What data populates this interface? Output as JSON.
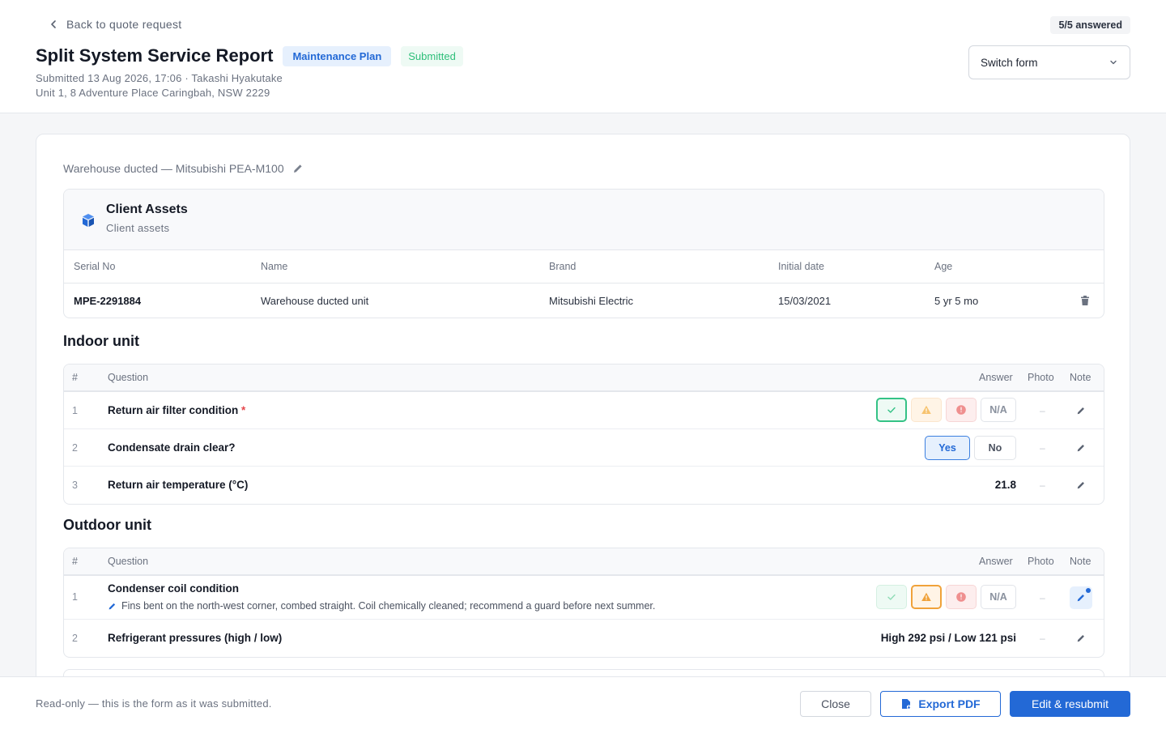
{
  "header": {
    "back_label": "Back to quote request",
    "answered": "5/5 answered",
    "title": "Split System Service Report",
    "plan_badge": "Maintenance Plan",
    "status_badge": "Submitted",
    "submitted_line": "Submitted 13 Aug 2026, 17:06 · Takashi Hyakutake",
    "address": "Unit 1, 8 Adventure Place Caringbah, NSW 2229",
    "switch_label": "Switch form"
  },
  "unit_title": "Warehouse ducted — Mitsubishi PEA-M100",
  "assets": {
    "title": "Client Assets",
    "subtitle": "Client assets",
    "columns": [
      "Serial No",
      "Name",
      "Brand",
      "Initial date",
      "Age"
    ],
    "row": {
      "serial": "MPE-2291884",
      "name": "Warehouse ducted unit",
      "brand": "Mitsubishi Electric",
      "initial_date": "15/03/2021",
      "age": "5 yr 5 mo"
    }
  },
  "table_columns": {
    "num": "#",
    "question": "Question",
    "answer": "Answer",
    "photo": "Photo",
    "note": "Note"
  },
  "indoor": {
    "title": "Indoor unit",
    "questions": [
      {
        "num": "1",
        "text": "Return air filter condition",
        "required": "*",
        "answer_type": "condition",
        "selected": "ok",
        "na_label": "N/A",
        "photo": "–"
      },
      {
        "num": "2",
        "text": "Condensate drain clear?",
        "answer_type": "yesno",
        "yes_label": "Yes",
        "no_label": "No",
        "selected": "yes",
        "photo": "–"
      },
      {
        "num": "3",
        "text": "Return air temperature (°C)",
        "answer_type": "value",
        "value": "21.8",
        "photo": "–"
      }
    ]
  },
  "outdoor": {
    "title": "Outdoor unit",
    "questions": [
      {
        "num": "1",
        "text": "Condenser coil condition",
        "note": "Fins bent on the north-west corner, combed straight. Coil chemically cleaned; recommend a guard before next summer.",
        "answer_type": "condition",
        "selected": "warn",
        "na_label": "N/A",
        "photo": "–"
      },
      {
        "num": "2",
        "text": "Refrigerant pressures (high / low)",
        "answer_type": "value",
        "value": "High 292 psi / Low 121 psi",
        "photo": "–"
      }
    ]
  },
  "footer": {
    "note": "Read-only — this is the form as it was submitted.",
    "close_label": "Close",
    "export_label": "Export PDF",
    "edit_label": "Edit & resubmit"
  },
  "colors": {
    "accent": "#2369d6",
    "ok": "#34c286",
    "warn": "#f0a23a",
    "bad": "#e5484d"
  }
}
